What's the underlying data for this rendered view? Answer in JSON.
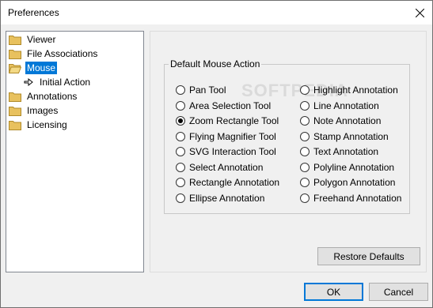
{
  "window": {
    "title": "Preferences"
  },
  "tree": {
    "items": [
      {
        "label": "Viewer"
      },
      {
        "label": "File Associations"
      },
      {
        "label": "Mouse"
      },
      {
        "label": "Initial Action"
      },
      {
        "label": "Annotations"
      },
      {
        "label": "Images"
      },
      {
        "label": "Licensing"
      }
    ]
  },
  "group": {
    "title": "Default Mouse Action",
    "left_options": [
      "Pan Tool",
      "Area Selection Tool",
      "Zoom Rectangle Tool",
      "Flying Magnifier Tool",
      "SVG Interaction Tool",
      "Select Annotation",
      "Rectangle Annotation",
      "Ellipse Annotation"
    ],
    "right_options": [
      "Highlight Annotation",
      "Line Annotation",
      "Note Annotation",
      "Stamp Annotation",
      "Text Annotation",
      "Polyline Annotation",
      "Polygon Annotation",
      "Freehand Annotation"
    ],
    "selected": "Zoom Rectangle Tool"
  },
  "buttons": {
    "restore": "Restore Defaults",
    "ok": "OK",
    "cancel": "Cancel"
  },
  "watermark": "SOFTPEDIA",
  "colors": {
    "selection": "#0078d7",
    "folder": "#e8c15e"
  }
}
